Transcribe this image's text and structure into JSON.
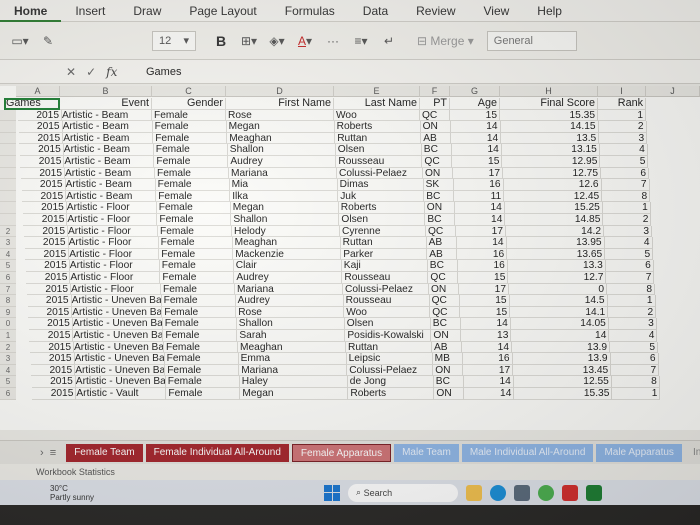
{
  "menubar": {
    "tabs": [
      "Home",
      "Insert",
      "Draw",
      "Page Layout",
      "Formulas",
      "Data",
      "Review",
      "View",
      "Help"
    ]
  },
  "toolbar": {
    "font_size": "12",
    "bold": "B",
    "merge": "Merge",
    "number_format": "General"
  },
  "formula_bar": {
    "fx": "fx",
    "content": "Games"
  },
  "columns": [
    "A",
    "B",
    "C",
    "D",
    "E",
    "F",
    "G",
    "H",
    "I",
    "J"
  ],
  "headers": [
    "Games",
    "Event",
    "Gender",
    "First Name",
    "Last Name",
    "PT",
    "Age",
    "Final Score",
    "Rank"
  ],
  "rows": [
    [
      "2015",
      "Artistic - Beam",
      "Female",
      "Rose",
      "Woo",
      "QC",
      "15",
      "15.35",
      "1"
    ],
    [
      "2015",
      "Artistic - Beam",
      "Female",
      "Megan",
      "Roberts",
      "ON",
      "14",
      "14.15",
      "2"
    ],
    [
      "2015",
      "Artistic - Beam",
      "Female",
      "Meaghan",
      "Ruttan",
      "AB",
      "14",
      "13.5",
      "3"
    ],
    [
      "2015",
      "Artistic - Beam",
      "Female",
      "Shallon",
      "Olsen",
      "BC",
      "14",
      "13.15",
      "4"
    ],
    [
      "2015",
      "Artistic - Beam",
      "Female",
      "Audrey",
      "Rousseau",
      "QC",
      "15",
      "12.95",
      "5"
    ],
    [
      "2015",
      "Artistic - Beam",
      "Female",
      "Mariana",
      "Colussi-Pelaez",
      "ON",
      "17",
      "12.75",
      "6"
    ],
    [
      "2015",
      "Artistic - Beam",
      "Female",
      "Mia",
      "Dimas",
      "SK",
      "16",
      "12.6",
      "7"
    ],
    [
      "2015",
      "Artistic - Beam",
      "Female",
      "Ilka",
      "Juk",
      "BC",
      "11",
      "12.45",
      "8"
    ],
    [
      "2015",
      "Artistic - Floor",
      "Female",
      "Megan",
      "Roberts",
      "ON",
      "14",
      "15.25",
      "1"
    ],
    [
      "2015",
      "Artistic - Floor",
      "Female",
      "Shallon",
      "Olsen",
      "BC",
      "14",
      "14.85",
      "2"
    ],
    [
      "2015",
      "Artistic - Floor",
      "Female",
      "Helody",
      "Cyrenne",
      "QC",
      "17",
      "14.2",
      "3"
    ],
    [
      "2015",
      "Artistic - Floor",
      "Female",
      "Meaghan",
      "Ruttan",
      "AB",
      "14",
      "13.95",
      "4"
    ],
    [
      "2015",
      "Artistic - Floor",
      "Female",
      "Mackenzie",
      "Parker",
      "AB",
      "16",
      "13.65",
      "5"
    ],
    [
      "2015",
      "Artistic - Floor",
      "Female",
      "Clair",
      "Kaji",
      "BC",
      "16",
      "13.3",
      "6"
    ],
    [
      "2015",
      "Artistic - Floor",
      "Female",
      "Audrey",
      "Rousseau",
      "QC",
      "15",
      "12.7",
      "7"
    ],
    [
      "2015",
      "Artistic - Floor",
      "Female",
      "Mariana",
      "Colussi-Pelaez",
      "ON",
      "17",
      "0",
      "8"
    ],
    [
      "2015",
      "Artistic - Uneven Bars",
      "Female",
      "Audrey",
      "Rousseau",
      "QC",
      "15",
      "14.5",
      "1"
    ],
    [
      "2015",
      "Artistic - Uneven Bars",
      "Female",
      "Rose",
      "Woo",
      "QC",
      "15",
      "14.1",
      "2"
    ],
    [
      "2015",
      "Artistic - Uneven Bars",
      "Female",
      "Shallon",
      "Olsen",
      "BC",
      "14",
      "14.05",
      "3"
    ],
    [
      "2015",
      "Artistic - Uneven Bars",
      "Female",
      "Sarah",
      "Posidis-Kowalski",
      "ON",
      "13",
      "14",
      "4"
    ],
    [
      "2015",
      "Artistic - Uneven Bars",
      "Female",
      "Meaghan",
      "Ruttan",
      "AB",
      "14",
      "13.9",
      "5"
    ],
    [
      "2015",
      "Artistic - Uneven Bars",
      "Female",
      "Emma",
      "Leipsic",
      "MB",
      "16",
      "13.9",
      "6"
    ],
    [
      "2015",
      "Artistic - Uneven Bars",
      "Female",
      "Mariana",
      "Colussi-Pelaez",
      "ON",
      "17",
      "13.45",
      "7"
    ],
    [
      "2015",
      "Artistic - Uneven Bars",
      "Female",
      "Haley",
      "de Jong",
      "BC",
      "14",
      "12.55",
      "8"
    ],
    [
      "2015",
      "Artistic - Vault",
      "Female",
      "Megan",
      "Roberts",
      "ON",
      "14",
      "15.35",
      "1"
    ]
  ],
  "row_numbers": [
    "",
    "",
    "",
    "",
    "",
    "",
    "",
    "",
    "",
    "",
    "2",
    "3",
    "4",
    "5",
    "6",
    "7",
    "8",
    "9",
    "0",
    "1",
    "2",
    "3",
    "4",
    "5",
    "6"
  ],
  "sheet_tabs": [
    {
      "label": "Female Team",
      "style": "red"
    },
    {
      "label": "Female Individual All-Around",
      "style": "red"
    },
    {
      "label": "Female Apparatus",
      "style": "pink"
    },
    {
      "label": "Male Team",
      "style": "blue"
    },
    {
      "label": "Male Individual All-Around",
      "style": "blue"
    },
    {
      "label": "Male Apparatus",
      "style": "blue"
    },
    {
      "label": "Individ",
      "style": "plain"
    }
  ],
  "status": {
    "text": "Workbook Statistics"
  },
  "taskbar": {
    "temperature": "30°C",
    "weather": "Partly sunny",
    "search": "Search"
  },
  "colors": {
    "accent": "#1e7e34",
    "tab_red": "#a4242b",
    "tab_blue": "#8fb6e6"
  }
}
